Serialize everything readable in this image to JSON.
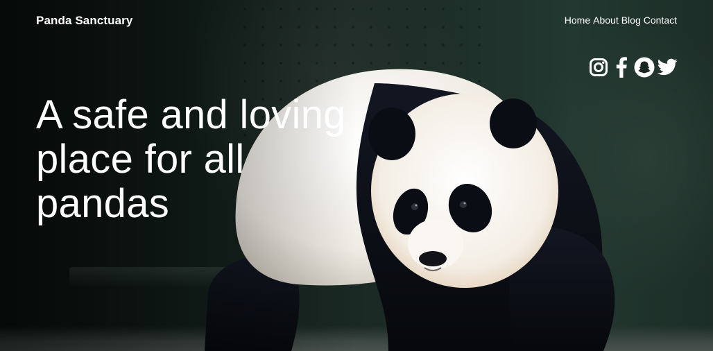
{
  "brand": {
    "name": "Panda Sanctuary"
  },
  "nav": {
    "items": [
      {
        "label": "Home"
      },
      {
        "label": "About"
      },
      {
        "label": "Blog"
      },
      {
        "label": "Contact"
      }
    ]
  },
  "socials": {
    "icons": [
      "instagram-icon",
      "facebook-icon",
      "snapchat-icon",
      "twitter-icon"
    ]
  },
  "hero": {
    "headline_lines": [
      "A safe and loving",
      "place for all",
      "pandas"
    ],
    "image_subject": "giant panda walking",
    "colors": {
      "text": "#ffffff",
      "background_dark": "#0e1a16",
      "panda_black": "#0b0e14",
      "panda_white": "#f6f3ee"
    }
  }
}
